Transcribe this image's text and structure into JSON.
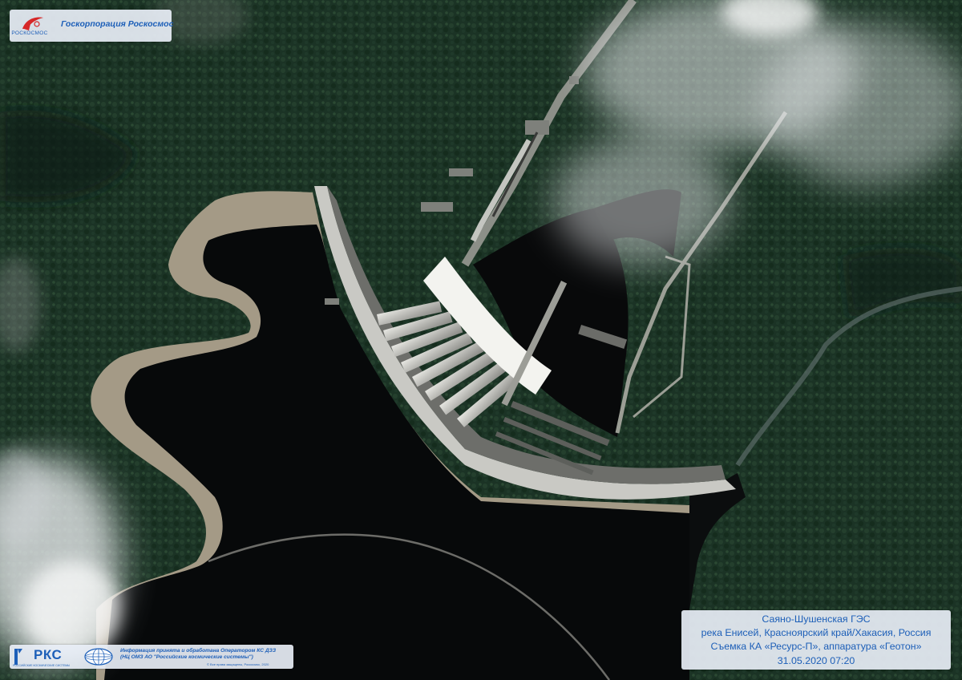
{
  "image": {
    "subject": "Satellite image of a hydroelectric dam on a reservoir"
  },
  "roscosmos_badge": {
    "org_name": "Госкорпорация Роскосмос",
    "logo_caption": "РОСКОСМОС",
    "logo_icon": "roscosmos-logo-icon"
  },
  "rks_badge": {
    "logo_text": "РКС",
    "logo_subtext": "РОССИЙСКИЕ КОСМИЧЕСКИЕ СИСТЕМЫ",
    "globe_icon": "globe-icon",
    "info_line_1": "Информация принята и обработана Оператором КС ДЗЗ",
    "info_line_2": "(НЦ ОМЗ АО \"Российские космические системы\")",
    "copyright": "© Все права защищены, Роскосмос, 2020"
  },
  "caption": {
    "line_1": "Саяно-Шушенская ГЭС",
    "line_2": "река Енисей, Красноярский край/Хакасия, Россия",
    "line_3": "Съемка КА «Ресурс-П», аппаратура «Геотон»",
    "line_4": "31.05.2020 07:20"
  },
  "colors": {
    "forest": "#1f3a2a",
    "water": "#07090a",
    "shore": "#a49a86",
    "dam": "#c9c9c4",
    "cloud": "#e9ecee",
    "brand_blue": "#1d5fb8"
  }
}
